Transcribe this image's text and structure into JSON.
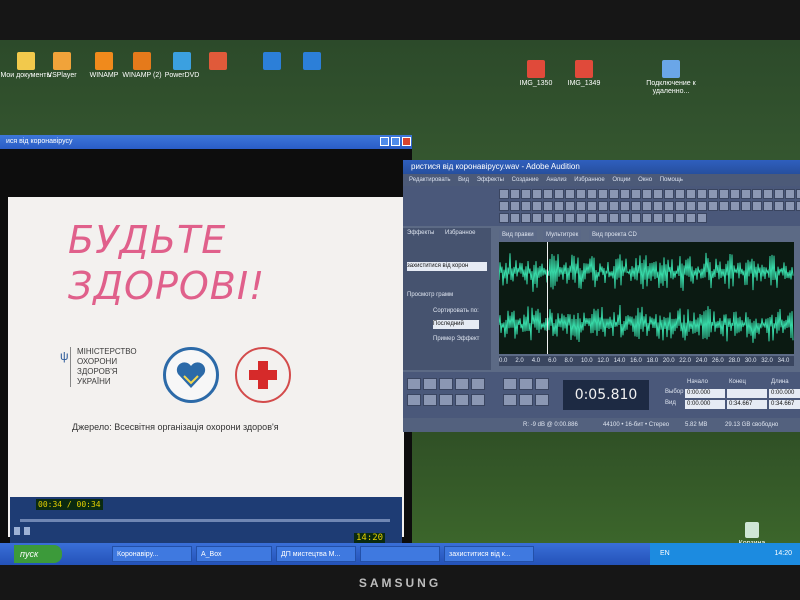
{
  "desktop": {
    "icons": [
      {
        "label": "Мои документы",
        "color": "#f2c94c"
      },
      {
        "label": "VSPlayer",
        "color": "#f1a33a"
      },
      {
        "label": "WINAMP",
        "color": "#f08a1c"
      },
      {
        "label": "WINAMP (2)",
        "color": "#e57a1b"
      },
      {
        "label": "PowerDVD",
        "color": "#3ba0e0"
      },
      {
        "label": "",
        "color": "#e05a3a"
      },
      {
        "label": "",
        "color": "#2c7fd8"
      },
      {
        "label": "",
        "color": "#2c7fd8"
      },
      {
        "label": "IMG_1350",
        "color": "#e04a3a"
      },
      {
        "label": "IMG_1349",
        "color": "#e04a3a"
      },
      {
        "label": "Подключение к удаленно...",
        "color": "#6aa6e8"
      }
    ],
    "recycle_bin": "Корзина"
  },
  "player": {
    "title": "ися від коронавірусу",
    "headline": [
      "БУДЬТЕ",
      "ЗДОРОВІ!"
    ],
    "ministry": [
      "МІНІСТЕРСТВО",
      "ОХОРОНИ",
      "ЗДОРОВ'Я",
      "УКРАЇНИ"
    ],
    "source": "Джерело: Всесвітня організація охорони здоров'я",
    "position": "00:34 / 00:34",
    "clock": "14:20"
  },
  "audition": {
    "title": "ристися від коронавірусу.wav - Adobe Audition",
    "menu": [
      "Редактировать",
      "Вид",
      "Эффекты",
      "Создание",
      "Анализ",
      "Избранное",
      "Опции",
      "Окно",
      "Помощь"
    ],
    "left_tabs": [
      "Эффекты",
      "Избранное"
    ],
    "file_item": "захиститися від корон",
    "left_labels": [
      "Просмотр грамм",
      "Сортировать по:",
      "Последний",
      "Пример Эффект"
    ],
    "view_tabs": [
      "Вид правки",
      "Мультитрек",
      "Вид проекта CD"
    ],
    "ruler_ticks": [
      "0.0",
      "2.0",
      "4.0",
      "6.0",
      "8.0",
      "10.0",
      "12.0",
      "14.0",
      "16.0",
      "18.0",
      "20.0",
      "22.0",
      "24.0",
      "26.0",
      "28.0",
      "30.0",
      "32.0",
      "34.0"
    ],
    "time_display": "0:05.810",
    "selection": {
      "headers": [
        "Начало",
        "Конец",
        "Длина"
      ],
      "rows": [
        {
          "label": "Выбор",
          "values": [
            "0:00.000",
            "",
            "0:00.000"
          ]
        },
        {
          "label": "Вид",
          "values": [
            "0:00.000",
            "0:34.667",
            "0:34.667"
          ]
        }
      ]
    },
    "status": [
      "R: -9 dB  @  0:00.886",
      "44100 • 16-бит • Стерео",
      "5.82 MB",
      "29.13 GB свободно"
    ],
    "wave_color": "#37d7a6"
  },
  "taskbar": {
    "start_label": "пуск",
    "items": [
      "Коронавіру...",
      "А_Вох",
      "ДП мистецтва М...",
      "",
      "захиститися від к..."
    ],
    "lang": "EN",
    "clock": "14:20"
  },
  "monitor": {
    "brand": "SAMSUNG"
  }
}
